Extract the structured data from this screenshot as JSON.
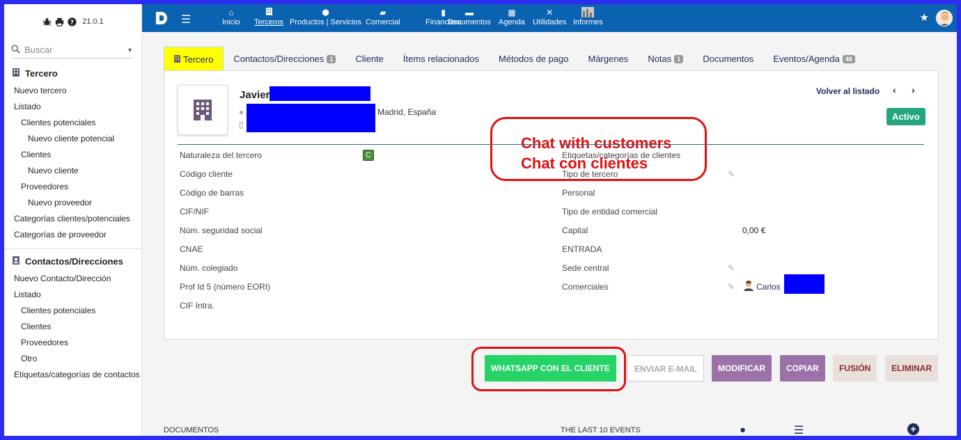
{
  "sidebar": {
    "version": "21.0.1",
    "search_placeholder": "Buscar",
    "section1_title": "Tercero",
    "section1_items": [
      "Nuevo tercero",
      "Listado",
      "Clientes potenciales",
      "Nuevo cliente potencial",
      "Clientes",
      "Nuevo cliente",
      "Proveedores",
      "Nuevo proveedor",
      "Categorías clientes/potenciales",
      "Categorías de proveedor"
    ],
    "section2_title": "Contactos/Direcciones",
    "section2_items": [
      "Nuevo Contacto/Dirección",
      "Listado",
      "Clientes potenciales",
      "Clientes",
      "Proveedores",
      "Otro",
      "Etiquetas/categorías de contactos"
    ]
  },
  "topnav": {
    "items": [
      "Inicio",
      "Terceros",
      "Productos | Servicios",
      "Comercial",
      "Financiera",
      "Documentos",
      "Agenda",
      "Utilidades",
      "Informes"
    ]
  },
  "tabs": {
    "items": [
      "Tercero",
      "Contactos/Direcciones",
      "Cliente",
      "Ítems relacionados",
      "Métodos de pago",
      "Márgenes",
      "Notas",
      "Documentos",
      "Eventos/Agenda"
    ],
    "badges": {
      "contactos": "1",
      "notas": "1",
      "eventos": "48"
    }
  },
  "card": {
    "name": "Javier",
    "city": "Madrid, España",
    "back_link": "Volver al listado",
    "status": "Activo"
  },
  "annotation": {
    "line1": "Chat with customers",
    "line2": "Chat con clientes"
  },
  "fields_left": [
    {
      "label": "Naturaleza del tercero",
      "value": "C"
    },
    {
      "label": "Código cliente",
      "value": ""
    },
    {
      "label": "Código de barras",
      "value": ""
    },
    {
      "label": "CIF/NIF",
      "value": ""
    },
    {
      "label": "Núm. seguridad social",
      "value": ""
    },
    {
      "label": "CNAE",
      "value": ""
    },
    {
      "label": "Núm. colegiado",
      "value": ""
    },
    {
      "label": "Prof Id 5 (número EORI)",
      "value": ""
    },
    {
      "label": "CIF Intra.",
      "value": ""
    }
  ],
  "fields_right": [
    {
      "label": "Etiquetas/categorías de clientes",
      "value": ""
    },
    {
      "label": "Tipo de tercero",
      "value": ""
    },
    {
      "label": "Personal",
      "value": ""
    },
    {
      "label": "Tipo de entidad comercial",
      "value": ""
    },
    {
      "label": "Capital",
      "value": "0,00 €"
    },
    {
      "label": "ENTRADA",
      "value": ""
    },
    {
      "label": "Sede central",
      "value": ""
    },
    {
      "label": "Comerciales",
      "value": "Carlos"
    }
  ],
  "buttons": {
    "whatsapp": "WHATSAPP CON EL CLIENTE",
    "email": "ENVIAR E-MAIL",
    "modify": "MODIFICAR",
    "copy": "COPIAR",
    "merge": "FUSIÓN",
    "delete": "ELIMINAR"
  },
  "bottom": {
    "documents": "DOCUMENTOS",
    "events": "THE LAST 10 EVENTS"
  },
  "colors": {
    "topbar": "#0a62b0",
    "whatsapp": "#25d366",
    "purple": "#9b72a8",
    "status": "#25a580"
  }
}
